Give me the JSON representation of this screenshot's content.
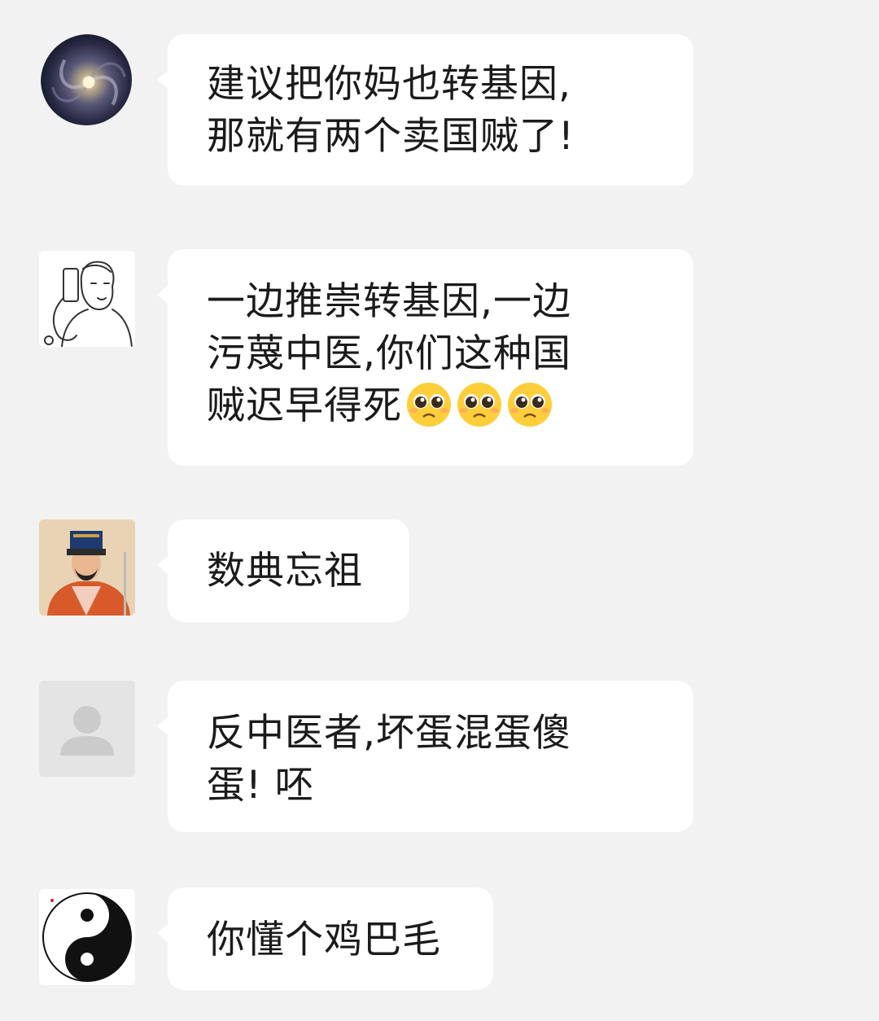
{
  "messages": [
    {
      "avatar_icon": "galaxy-avatar-icon",
      "lines": [
        "建议把你妈也转基因,",
        "那就有两个卖国贼了!"
      ]
    },
    {
      "avatar_icon": "sketch-man-avatar-icon",
      "lines": [
        "一边推崇转基因,一边",
        "污蔑中医,你们这种国",
        "贼迟早得死"
      ],
      "emoji_icon": "pleading-face-emoji-icon",
      "emoji_count": 3
    },
    {
      "avatar_icon": "ancient-official-avatar-icon",
      "lines": [
        "数典忘祖"
      ]
    },
    {
      "avatar_icon": "default-person-avatar-icon",
      "lines": [
        "反中医者,坏蛋混蛋傻",
        "蛋! 呸"
      ]
    },
    {
      "avatar_icon": "yin-yang-avatar-icon",
      "lines": [
        "你懂个鸡巴毛"
      ]
    }
  ],
  "colors": {
    "background": "#f2f2f2",
    "bubble": "#ffffff",
    "text": "#1b1b1b"
  }
}
